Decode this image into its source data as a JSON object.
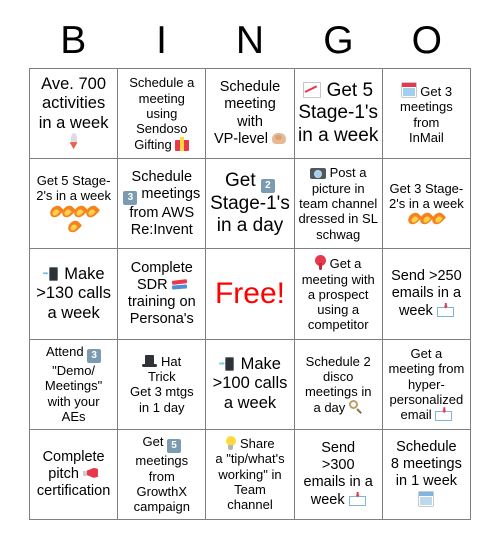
{
  "header": {
    "letters": [
      "B",
      "I",
      "N",
      "G",
      "O"
    ]
  },
  "colors": {
    "free_text": "#ff0000",
    "grid_line": "#808080",
    "background": "#ffffff",
    "text": "#000000"
  },
  "grid": {
    "rows": 5,
    "columns": 5,
    "cells": [
      {
        "id": "b1",
        "text": "Ave. 700 activities in a week",
        "icons": [
          "rocket-icon"
        ],
        "icon_position": "after",
        "size": "fs-lg"
      },
      {
        "id": "i1",
        "text": "Schedule a meeting using Sendoso Gifting",
        "icons": [
          "gift-icon"
        ],
        "icon_position": "after-inline",
        "size": "fs-sm"
      },
      {
        "id": "n1",
        "text": "Schedule meeting with VP-level",
        "icons": [
          "flexed-bicep-icon"
        ],
        "icon_position": "after-inline",
        "size": "fs-md"
      },
      {
        "id": "g1",
        "text": "Get 5 Stage-1's in a week",
        "icons": [
          "chart-increasing-icon"
        ],
        "icon_position": "before",
        "size": "fs-xl"
      },
      {
        "id": "o1",
        "text": "Get 3 meetings from InMail",
        "icons": [
          "calendar-icon"
        ],
        "icon_position": "before",
        "size": "fs-sm"
      },
      {
        "id": "b2",
        "text": "Get 5 Stage-2's in a week",
        "icons": [
          "fire-icon",
          "fire-icon",
          "fire-icon",
          "fire-icon",
          "fire-icon"
        ],
        "icon_position": "below",
        "size": "fs-sm"
      },
      {
        "id": "i2",
        "text": "Schedule 3 meetings from AWS Re:Invent",
        "keycap": "3",
        "icons": [
          "keycap-3-icon"
        ],
        "icon_position": "inline",
        "size": "fs-md"
      },
      {
        "id": "n2",
        "text": "Get 2 Stage-1's in a day",
        "keycap": "2",
        "icons": [
          "keycap-2-icon"
        ],
        "icon_position": "inline",
        "size": "fs-xl"
      },
      {
        "id": "g2",
        "text": "Post a picture in team channel dressed in SL schwag",
        "icons": [
          "camera-icon"
        ],
        "icon_position": "before",
        "size": "fs-sm"
      },
      {
        "id": "o2",
        "text": "Get 3 Stage-2's in a week",
        "icons": [
          "fire-icon",
          "fire-icon",
          "fire-icon"
        ],
        "icon_position": "below",
        "size": "fs-sm"
      },
      {
        "id": "b3",
        "text": "Make >130 calls a week",
        "icons": [
          "mobile-phone-arrow-icon"
        ],
        "icon_position": "before",
        "size": "fs-lg"
      },
      {
        "id": "i3",
        "text": "Complete SDR training on Persona's",
        "icons": [
          "books-icon"
        ],
        "icon_position": "inline",
        "size": "fs-md"
      },
      {
        "id": "n3",
        "text": "Free!",
        "icons": [],
        "icon_position": "none",
        "size": "free"
      },
      {
        "id": "g3",
        "text": "Get a meeting with a prospect using a competitor",
        "icons": [
          "pushpin-icon"
        ],
        "icon_position": "before",
        "size": "fs-sm"
      },
      {
        "id": "o3",
        "text": "Send >250 emails in a week",
        "icons": [
          "incoming-envelope-icon"
        ],
        "icon_position": "after-inline",
        "size": "fs-md"
      },
      {
        "id": "b4",
        "text": "Attend 3 \"Demo/ Meetings\" with your AEs",
        "keycap": "3",
        "icons": [
          "keycap-3-icon"
        ],
        "icon_position": "inline",
        "size": "fs-sm"
      },
      {
        "id": "i4",
        "text": "Hat Trick Get 3 mtgs in 1 day",
        "icons": [
          "top-hat-icon"
        ],
        "icon_position": "before",
        "size": "fs-sm"
      },
      {
        "id": "n4",
        "text": "Make >100 calls a week",
        "icons": [
          "mobile-phone-arrow-icon"
        ],
        "icon_position": "before",
        "size": "fs-lg"
      },
      {
        "id": "g4",
        "text": "Schedule 2 disco meetings in a day",
        "icons": [
          "magnifying-glass-icon"
        ],
        "icon_position": "after-inline",
        "size": "fs-sm"
      },
      {
        "id": "o4",
        "text": "Get a meeting from hyper-personalized email",
        "icons": [
          "incoming-envelope-icon"
        ],
        "icon_position": "after-inline",
        "size": "fs-sm"
      },
      {
        "id": "b5",
        "text": "Complete pitch certification",
        "icons": [
          "megaphone-icon"
        ],
        "icon_position": "inline",
        "size": "fs-md"
      },
      {
        "id": "i5",
        "text": "Get 5 meetings from GrowthX campaign",
        "keycap": "5",
        "icons": [
          "keycap-5-icon"
        ],
        "icon_position": "inline",
        "size": "fs-sm"
      },
      {
        "id": "n5",
        "text": "Share a \"tip/what's working\" in Team channel",
        "icons": [
          "light-bulb-icon"
        ],
        "icon_position": "before",
        "size": "fs-sm"
      },
      {
        "id": "g5",
        "text": "Send >300 emails in a week",
        "icons": [
          "incoming-envelope-icon"
        ],
        "icon_position": "after-inline",
        "size": "fs-md"
      },
      {
        "id": "o5",
        "text": "Schedule 8 meetings in 1 week",
        "icons": [
          "calendar-blue-icon"
        ],
        "icon_position": "below",
        "size": "fs-md"
      }
    ]
  }
}
